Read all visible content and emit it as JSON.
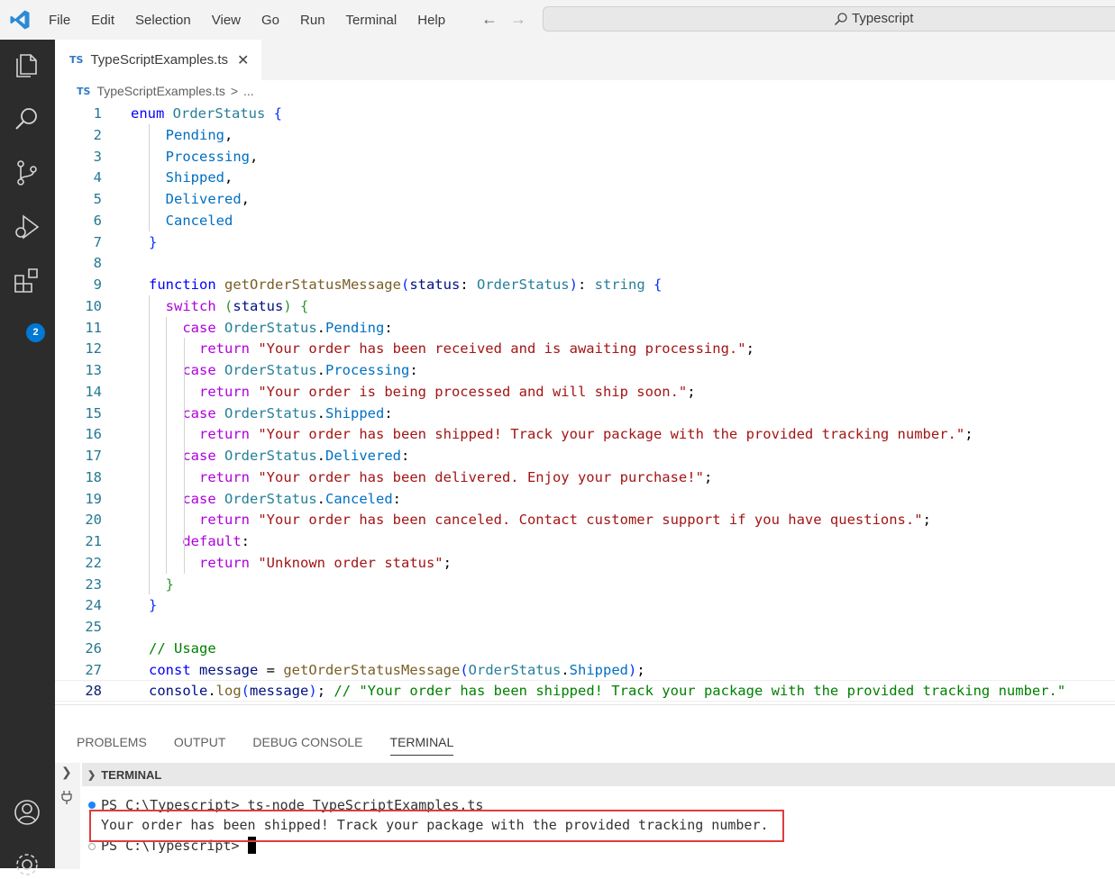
{
  "menu": [
    "File",
    "Edit",
    "Selection",
    "View",
    "Go",
    "Run",
    "Terminal",
    "Help"
  ],
  "command_center": {
    "text": "Typescript"
  },
  "activity_bar": {
    "extensions_badge": "2"
  },
  "tab": {
    "lang": "TS",
    "filename": "TypeScriptExamples.ts"
  },
  "breadcrumb": {
    "lang": "TS",
    "filename": "TypeScriptExamples.ts",
    "sep": ">",
    "more": "..."
  },
  "code": {
    "line_numbers": [
      "1",
      "2",
      "3",
      "4",
      "5",
      "6",
      "7",
      "8",
      "9",
      "10",
      "11",
      "12",
      "13",
      "14",
      "15",
      "16",
      "17",
      "18",
      "19",
      "20",
      "21",
      "22",
      "23",
      "24",
      "25",
      "26",
      "27",
      "28"
    ],
    "lines": [
      [
        [
          "enum",
          "kw"
        ],
        [
          " "
        ],
        [
          "OrderStatus",
          "ty"
        ],
        [
          " "
        ],
        [
          "{",
          "br1"
        ]
      ],
      [
        [
          "  "
        ],
        [
          "Pending",
          "em"
        ],
        [
          ","
        ]
      ],
      [
        [
          "  "
        ],
        [
          "Processing",
          "em"
        ],
        [
          ","
        ]
      ],
      [
        [
          "  "
        ],
        [
          "Shipped",
          "em"
        ],
        [
          ","
        ]
      ],
      [
        [
          "  "
        ],
        [
          "Delivered",
          "em"
        ],
        [
          ","
        ]
      ],
      [
        [
          "  "
        ],
        [
          "Canceled",
          "em"
        ]
      ],
      [
        [
          "}",
          "br1"
        ]
      ],
      [],
      [
        [
          "function",
          "kw"
        ],
        [
          " "
        ],
        [
          "getOrderStatusMessage",
          "fn"
        ],
        [
          "(",
          "br1"
        ],
        [
          "status",
          "var"
        ],
        [
          ": "
        ],
        [
          "OrderStatus",
          "ty"
        ],
        [
          ")",
          "br1"
        ],
        [
          ": "
        ],
        [
          "string",
          "ty"
        ],
        [
          " "
        ],
        [
          "{",
          "br1"
        ]
      ],
      [
        [
          "  "
        ],
        [
          "switch",
          "ctl"
        ],
        [
          " "
        ],
        [
          "(",
          "br2"
        ],
        [
          "status",
          "var"
        ],
        [
          ")",
          "br2"
        ],
        [
          " "
        ],
        [
          "{",
          "br2"
        ]
      ],
      [
        [
          "    "
        ],
        [
          "case",
          "ctl"
        ],
        [
          " "
        ],
        [
          "OrderStatus",
          "ty"
        ],
        [
          "."
        ],
        [
          "Pending",
          "em"
        ],
        [
          ":"
        ]
      ],
      [
        [
          "      "
        ],
        [
          "return",
          "ctl"
        ],
        [
          " "
        ],
        [
          "\"Your order has been received and is awaiting processing.\"",
          "str"
        ],
        [
          ";"
        ]
      ],
      [
        [
          "    "
        ],
        [
          "case",
          "ctl"
        ],
        [
          " "
        ],
        [
          "OrderStatus",
          "ty"
        ],
        [
          "."
        ],
        [
          "Processing",
          "em"
        ],
        [
          ":"
        ]
      ],
      [
        [
          "      "
        ],
        [
          "return",
          "ctl"
        ],
        [
          " "
        ],
        [
          "\"Your order is being processed and will ship soon.\"",
          "str"
        ],
        [
          ";"
        ]
      ],
      [
        [
          "    "
        ],
        [
          "case",
          "ctl"
        ],
        [
          " "
        ],
        [
          "OrderStatus",
          "ty"
        ],
        [
          "."
        ],
        [
          "Shipped",
          "em"
        ],
        [
          ":"
        ]
      ],
      [
        [
          "      "
        ],
        [
          "return",
          "ctl"
        ],
        [
          " "
        ],
        [
          "\"Your order has been shipped! Track your package with the provided tracking number.\"",
          "str"
        ],
        [
          ";"
        ]
      ],
      [
        [
          "    "
        ],
        [
          "case",
          "ctl"
        ],
        [
          " "
        ],
        [
          "OrderStatus",
          "ty"
        ],
        [
          "."
        ],
        [
          "Delivered",
          "em"
        ],
        [
          ":"
        ]
      ],
      [
        [
          "      "
        ],
        [
          "return",
          "ctl"
        ],
        [
          " "
        ],
        [
          "\"Your order has been delivered. Enjoy your purchase!\"",
          "str"
        ],
        [
          ";"
        ]
      ],
      [
        [
          "    "
        ],
        [
          "case",
          "ctl"
        ],
        [
          " "
        ],
        [
          "OrderStatus",
          "ty"
        ],
        [
          "."
        ],
        [
          "Canceled",
          "em"
        ],
        [
          ":"
        ]
      ],
      [
        [
          "      "
        ],
        [
          "return",
          "ctl"
        ],
        [
          " "
        ],
        [
          "\"Your order has been canceled. Contact customer support if you have questions.\"",
          "str"
        ],
        [
          ";"
        ]
      ],
      [
        [
          "    "
        ],
        [
          "default",
          "ctl"
        ],
        [
          ":"
        ]
      ],
      [
        [
          "      "
        ],
        [
          "return",
          "ctl"
        ],
        [
          " "
        ],
        [
          "\"Unknown order status\"",
          "str"
        ],
        [
          ";"
        ]
      ],
      [
        [
          "  "
        ],
        [
          "}",
          "br2"
        ]
      ],
      [
        [
          "}",
          "br1"
        ]
      ],
      [],
      [
        [
          "// Usage",
          "cm"
        ]
      ],
      [
        [
          "const",
          "kw"
        ],
        [
          " "
        ],
        [
          "message",
          "var"
        ],
        [
          " = "
        ],
        [
          "getOrderStatusMessage",
          "fn"
        ],
        [
          "(",
          "br1"
        ],
        [
          "OrderStatus",
          "ty"
        ],
        [
          "."
        ],
        [
          "Shipped",
          "em"
        ],
        [
          ")",
          "br1"
        ],
        [
          ";"
        ]
      ],
      [
        [
          "console",
          "var"
        ],
        [
          "."
        ],
        [
          "log",
          "fn"
        ],
        [
          "(",
          "br1"
        ],
        [
          "message",
          "var"
        ],
        [
          ")",
          "br1"
        ],
        [
          "; "
        ],
        [
          "// \"Your order has been shipped! Track your package with the provided tracking number.\"",
          "cm"
        ]
      ]
    ]
  },
  "panel": {
    "tabs": [
      "PROBLEMS",
      "OUTPUT",
      "DEBUG CONSOLE",
      "TERMINAL"
    ],
    "active_tab": "TERMINAL",
    "terminal_title": "TERMINAL",
    "lines": [
      "PS C:\\Typescript> ts-node TypeScriptExamples.ts",
      "Your order has been shipped! Track your package with the provided tracking number.",
      "PS C:\\Typescript> "
    ]
  },
  "colors": {
    "accent": "#0078d4",
    "highlight_box": "#e23b3b"
  }
}
